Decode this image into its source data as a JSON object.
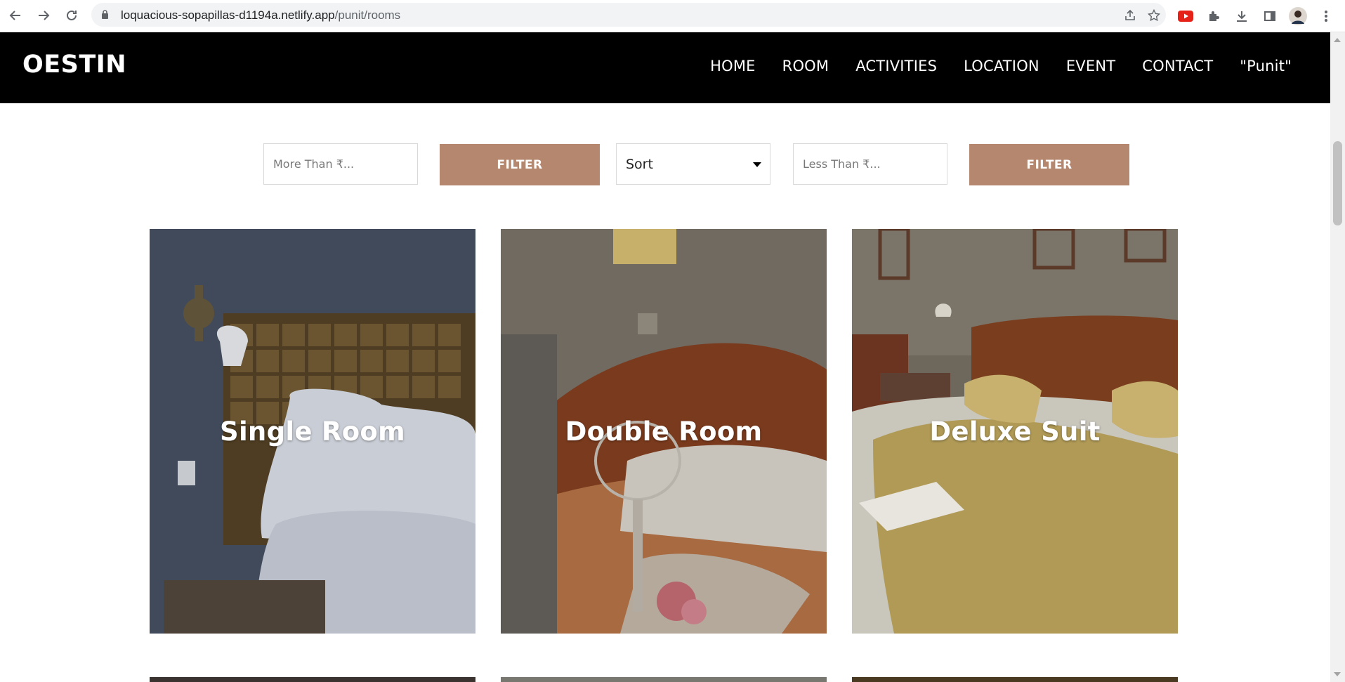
{
  "browser": {
    "url_host": "loquacious-sopapillas-d1194a.netlify.app",
    "url_path": "/punit/rooms"
  },
  "site": {
    "logo": "OESTIN",
    "menu": [
      "HOME",
      "ROOM",
      "ACTIVITIES",
      "LOCATION",
      "EVENT",
      "CONTACT",
      "\"Punit\""
    ]
  },
  "filters": {
    "more_than_placeholder": "More Than ₹...",
    "filter_label": "FILTER",
    "sort_label": "Sort",
    "less_than_placeholder": "Less Than ₹..."
  },
  "rooms": [
    {
      "title": "Single Room"
    },
    {
      "title": "Double Room"
    },
    {
      "title": "Deluxe Suit"
    }
  ],
  "colors": {
    "header_bg": "#000000",
    "filter_button": "#b5876f"
  }
}
